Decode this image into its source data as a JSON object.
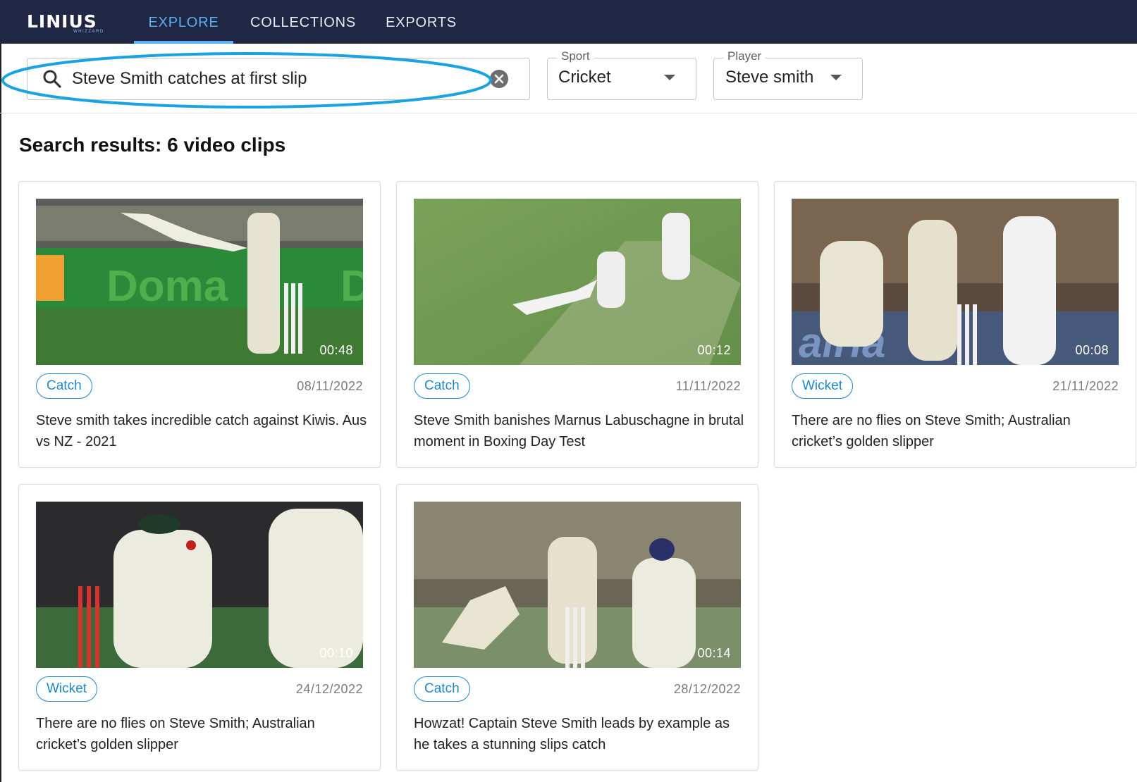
{
  "app": {
    "logo_text": "LINIUS",
    "logo_subtext": "WHIZZARD"
  },
  "nav": {
    "tabs": [
      {
        "label": "EXPLORE",
        "active": true
      },
      {
        "label": "COLLECTIONS",
        "active": false
      },
      {
        "label": "EXPORTS",
        "active": false
      }
    ]
  },
  "search": {
    "value": "Steve Smith catches at first slip",
    "placeholder": ""
  },
  "filters": {
    "sport": {
      "label": "Sport",
      "value": "Cricket"
    },
    "player": {
      "label": "Player",
      "value": "Steve smith"
    }
  },
  "results": {
    "heading": "Search results:  6 video clips",
    "clips": [
      {
        "tag": "Catch",
        "date": "08/11/2022",
        "duration": "00:48",
        "title": "Steve smith takes incredible catch against Kiwis. Aus vs NZ - 2021"
      },
      {
        "tag": "Catch",
        "date": "11/11/2022",
        "duration": "00:12",
        "title": "Steve Smith banishes Marnus Labuschagne in brutal moment in Boxing Day Test"
      },
      {
        "tag": "Wicket",
        "date": "21/11/2022",
        "duration": "00:08",
        "title": "There are no flies on Steve Smith; Australian cricket’s golden slipper"
      },
      {
        "tag": "Wicket",
        "date": "24/12/2022",
        "duration": "00:10",
        "title": "There are no flies on Steve Smith; Australian cricket’s golden slipper"
      },
      {
        "tag": "Catch",
        "date": "28/12/2022",
        "duration": "00:14",
        "title": "Howzat! Captain Steve Smith leads by example as he takes a stunning slips catch"
      }
    ]
  },
  "colors": {
    "nav_bg": "#1f2745",
    "accent": "#5ab0f0",
    "tag": "#1e88c8",
    "highlight": "#1aa3e0"
  }
}
